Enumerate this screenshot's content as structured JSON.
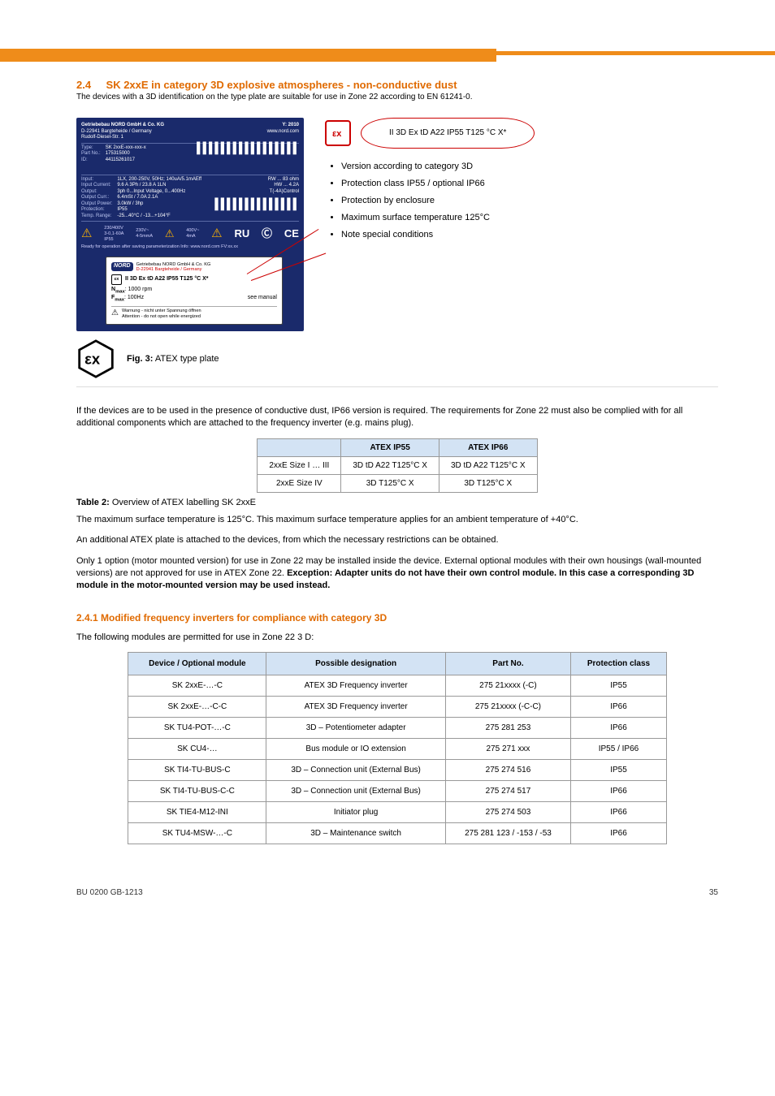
{
  "section": {
    "number": "2.4",
    "title": "SK 2xxE in category 3D explosive atmospheres - non-conductive dust",
    "subtitle": "The devices with a 3D identification on the type plate are suitable for use in Zone 22 according to EN 61241-0."
  },
  "annotation": {
    "label": "II 3D Ex tD A22 IP55 T125 °C X*",
    "bullets": [
      "Version according to category 3D",
      "Protection class IP55 / optional IP66",
      "Protection by enclosure",
      "Maximum surface temperature 125°C",
      "Note special conditions"
    ]
  },
  "nameplate_outer": {
    "l1": "Getriebebau NORD GmbH & Co. KG",
    "l2": "D-22941 Bargteheide / Germany",
    "l3": "Rudolf-Diesel-Str. 1",
    "year": "Y: 2010",
    "url": "www.nord.com",
    "mid_left": "Type:\nPart No.:\nID:",
    "mid_left_v": "SK 2xxE-xxx-xxx-x\n175315000\n44115261017",
    "mid2_left": "Input:\nInput Current:\nOutput:\nOutput Curr.:\nOutput Power:\nProtection:\nTemp. Range:",
    "mid2_left_v": "1LX, 200-250V, 50Hz; 140uA/5.1mAEff\n9.6 A 3Ph / 23.8 A 1LN\n3ph 0...Input Voltage, 0...400Hz\n6.4mSt / 7.0A 2.1A\n3.0kW / 3hp\nIP55\n-25...40°C / -13...+104°F",
    "mid2_right": "RW ... 83 ohm\nHW ... 4.2A\nT(-4A)Control",
    "bottom_note": "Ready for operation after saving parameterization   Info: www.nord.com   FV:xx.xx"
  },
  "nameplate_inner": {
    "brand": "NORD",
    "company": "Getriebebau NORD GmbH & Co. KG",
    "addr": "D-22941 Bargteheide / Germany",
    "ex": "II 3D Ex tD A22 IP55 T125 °C X*",
    "nmax_label": "N",
    "nmax_sub": "max",
    "nmax_val": ": 1000 rpm",
    "fmax_label": "F",
    "fmax_sub": "max",
    "fmax_val": ": 100Hz",
    "see": "see manual",
    "warn_de": "Warnung - nicht unter Spannung öffnen",
    "warn_en": "Attention - do not open while energized"
  },
  "figure_caption": {
    "prefix": "Fig. 3:",
    "text": "ATEX type plate"
  },
  "para1": "If the devices are to be used in the presence of conductive dust, IP66 version is required. The requirements for Zone 22 must also be complied with for all additional components which are attached to the frequency inverter (e.g. mains plug).",
  "table1": {
    "headers": [
      "",
      "ATEX IP55",
      "ATEX IP66"
    ],
    "rows": [
      [
        "2xxE Size I … III",
        "3D tD A22 T125°C X",
        "3D tD A22 T125°C X"
      ],
      [
        "2xxE Size IV",
        "3D T125°C X",
        "3D T125°C X"
      ]
    ],
    "caption_prefix": "Table 2:",
    "caption_text": "Overview of ATEX labelling SK 2xxE"
  },
  "para2": "The maximum surface temperature is 125°C. This maximum surface temperature applies for an ambient temperature of +40°C.",
  "para3": "An additional ATEX plate is attached to the devices, from which the necessary restrictions can be obtained.",
  "para4_1": "Only 1 option (motor mounted version) for use in Zone 22 may be installed inside the device. ",
  "para4_2": "External optional modules with their own housings (wall-mounted versions) are not approved for use in ATEX Zone 22.",
  "para4_bold": "Exception: Adapter units do not have their own control module. In this case a corresponding 3D module in the motor-mounted version may be used instead.",
  "subsection_title": "2.4.1 Modified frequency inverters for compliance with category 3D",
  "para5": "The following modules are permitted for use in Zone 22 3 D:",
  "table2": {
    "headers": [
      "Device / Optional module",
      "Possible designation",
      "Part No.",
      "Protection class"
    ],
    "rows": [
      [
        "SK 2xxE-…-C",
        "ATEX 3D Frequency inverter",
        "275 21xxxx (-C)",
        "IP55"
      ],
      [
        "SK 2xxE-…-C-C",
        "ATEX 3D Frequency inverter",
        "275 21xxxx (-C-C)",
        "IP66"
      ],
      [
        "SK TU4-POT-…-C",
        "3D – Potentiometer adapter",
        "275 281 253",
        "IP66"
      ],
      [
        "SK CU4-…",
        "Bus module or IO extension",
        "275 271 xxx",
        "IP55 / IP66"
      ],
      [
        "SK TI4-TU-BUS-C",
        "3D – Connection unit (External Bus)",
        "275 274 516",
        "IP55"
      ],
      [
        "SK TI4-TU-BUS-C-C",
        "3D – Connection unit (External Bus)",
        "275 274 517",
        "IP66"
      ],
      [
        "SK TIE4-M12-INI",
        "Initiator plug",
        "275 274 503",
        "IP66"
      ],
      [
        "SK TU4-MSW-…-C",
        "3D – Maintenance switch",
        "275 281 123 / -153 / -53",
        "IP66"
      ]
    ]
  },
  "footer": {
    "left": "BU 0200 GB-1213",
    "right": "35"
  }
}
